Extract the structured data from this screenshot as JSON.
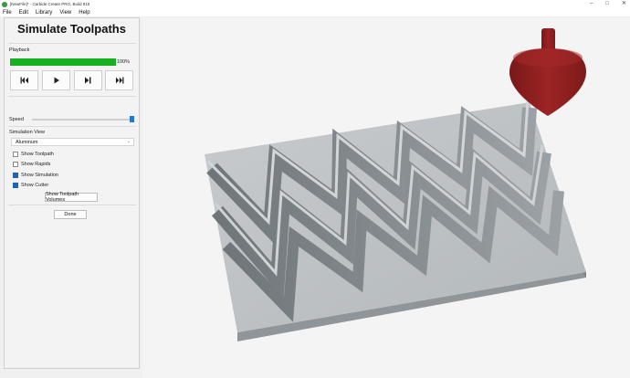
{
  "window": {
    "title": "[NewFile]* - Carbide Create PRO, Build 815"
  },
  "menubar": {
    "items": [
      "File",
      "Edit",
      "Library",
      "View",
      "Help"
    ]
  },
  "panel": {
    "title": "Simulate Toolpaths",
    "playback_label": "Playback",
    "progress_percent": 100,
    "progress_text": "100%",
    "speed_label": "Speed",
    "speed_level": 1.0,
    "sim_view_label": "Simulation View",
    "sim_view_value": "Aluminum",
    "checkboxes": [
      {
        "label": "Show Toolpath",
        "checked": false
      },
      {
        "label": "Show Rapids",
        "checked": false
      },
      {
        "label": "Show Simulation",
        "checked": true
      },
      {
        "label": "Show Cutter",
        "checked": true
      }
    ],
    "volumes_button": "Show Toolpath Volumes",
    "done_button": "Done"
  },
  "colors": {
    "progress": "#16b021",
    "accent": "#1e63b8",
    "cutter": "#8f1f1f",
    "stock": "#b9bec1"
  },
  "icons": {
    "app": "carbide-app-icon",
    "controls": [
      "skip-back-icon",
      "play-icon",
      "step-forward-icon",
      "skip-forward-icon"
    ]
  }
}
